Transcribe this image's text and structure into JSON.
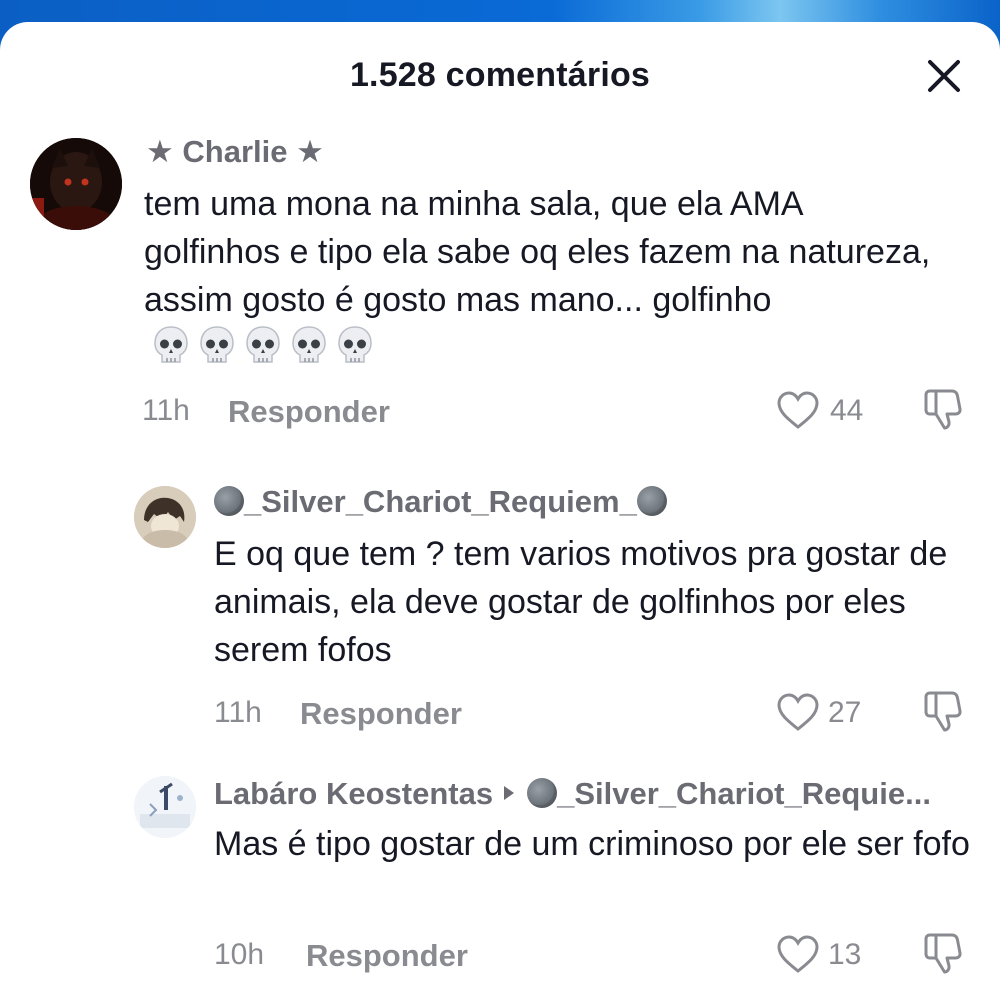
{
  "header": {
    "title": "1.528 comentários"
  },
  "comments": [
    {
      "username": "★ Charlie ★",
      "text": "tem uma mona na minha sala, que ela AMA golfinhos e tipo ela sabe oq eles fazem na natureza, assim gosto é gosto mas mano... golfinho",
      "emoji": "skull-icon x5",
      "time": "11h",
      "reply_label": "Responder",
      "likes": "44"
    },
    {
      "username": "_Silver_Chariot_Requiem_",
      "text": "E oq que tem ? tem varios motivos pra gostar de animais, ela deve gostar de golfinhos por eles serem fofos",
      "time": "11h",
      "reply_label": "Responder",
      "likes": "27"
    },
    {
      "username": "Labáro Keostentas",
      "reply_to": "_Silver_Chariot_Requie...",
      "text": "Mas é tipo gostar de um criminoso por ele ser fofo",
      "time": "10h",
      "reply_label": "Responder",
      "likes": "13"
    }
  ],
  "colors": {
    "text": "#161823",
    "muted": "#8a8b91",
    "accent_bg": "#0a63c9"
  }
}
